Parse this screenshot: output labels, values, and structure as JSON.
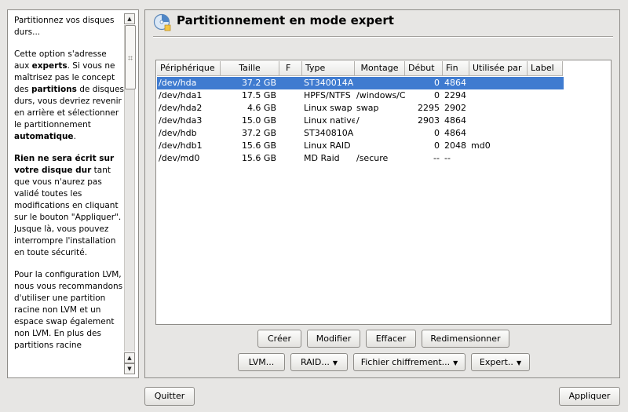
{
  "help": {
    "p1": "Partitionnez vos disques durs...",
    "p2_a": "Cette option s'adresse aux ",
    "p2_b": "experts",
    "p2_c": ". Si vous ne maîtrisez pas le concept des ",
    "p2_d": "partitions",
    "p2_e": " de disques durs, vous devriez revenir en arrière et sélectionner le partitionnement ",
    "p2_f": "automatique",
    "p2_g": ".",
    "p3_a": "Rien ne sera écrit sur votre disque dur",
    "p3_b": " tant que vous n'aurez pas validé toutes les modifications en cliquant sur le bouton \"Appliquer\". Jusque là, vous pouvez interrompre l'installation en toute sécurité.",
    "p4": "Pour la configuration LVM, nous vous recommandons d'utiliser une partition racine non LVM et un espace swap également non LVM. En plus des partitions racine"
  },
  "main": {
    "title": "Partitionnement en mode expert"
  },
  "table": {
    "columns": [
      "Périphérique",
      "Taille",
      "F",
      "Type",
      "Montage",
      "Début",
      "Fin",
      "Utilisée par",
      "Label"
    ],
    "rows": [
      [
        "/dev/hda",
        "37.2 GB",
        "",
        "ST340014A",
        "",
        "0",
        "4864",
        "",
        ""
      ],
      [
        "/dev/hda1",
        "17.5 GB",
        "",
        "HPFS/NTFS",
        "/windows/C",
        "0",
        "2294",
        "",
        ""
      ],
      [
        "/dev/hda2",
        "4.6 GB",
        "",
        "Linux swap",
        "swap",
        "2295",
        "2902",
        "",
        ""
      ],
      [
        "/dev/hda3",
        "15.0 GB",
        "",
        "Linux native",
        "/",
        "2903",
        "4864",
        "",
        ""
      ],
      [
        "/dev/hdb",
        "37.2 GB",
        "",
        "ST340810A",
        "",
        "0",
        "4864",
        "",
        ""
      ],
      [
        "/dev/hdb1",
        "15.6 GB",
        "",
        "Linux RAID",
        "",
        "0",
        "2048",
        "md0",
        ""
      ],
      [
        "/dev/md0",
        "15.6 GB",
        "",
        "MD Raid",
        "/secure",
        "--",
        "--",
        "",
        ""
      ]
    ],
    "selected_row": 0
  },
  "buttons": {
    "create": "Créer",
    "modify": "Modifier",
    "delete": "Effacer",
    "resize": "Redimensionner",
    "lvm": "LVM...",
    "raid": "RAID...",
    "crypt": "Fichier chiffrement...",
    "expert": "Expert..",
    "quit": "Quitter",
    "apply": "Appliquer"
  },
  "icons": {
    "title": "disk-partition-icon",
    "menu_arrow": "triangle-down-icon"
  },
  "colors": {
    "selection": "#3f7bd0",
    "background": "#e7e6e4"
  }
}
